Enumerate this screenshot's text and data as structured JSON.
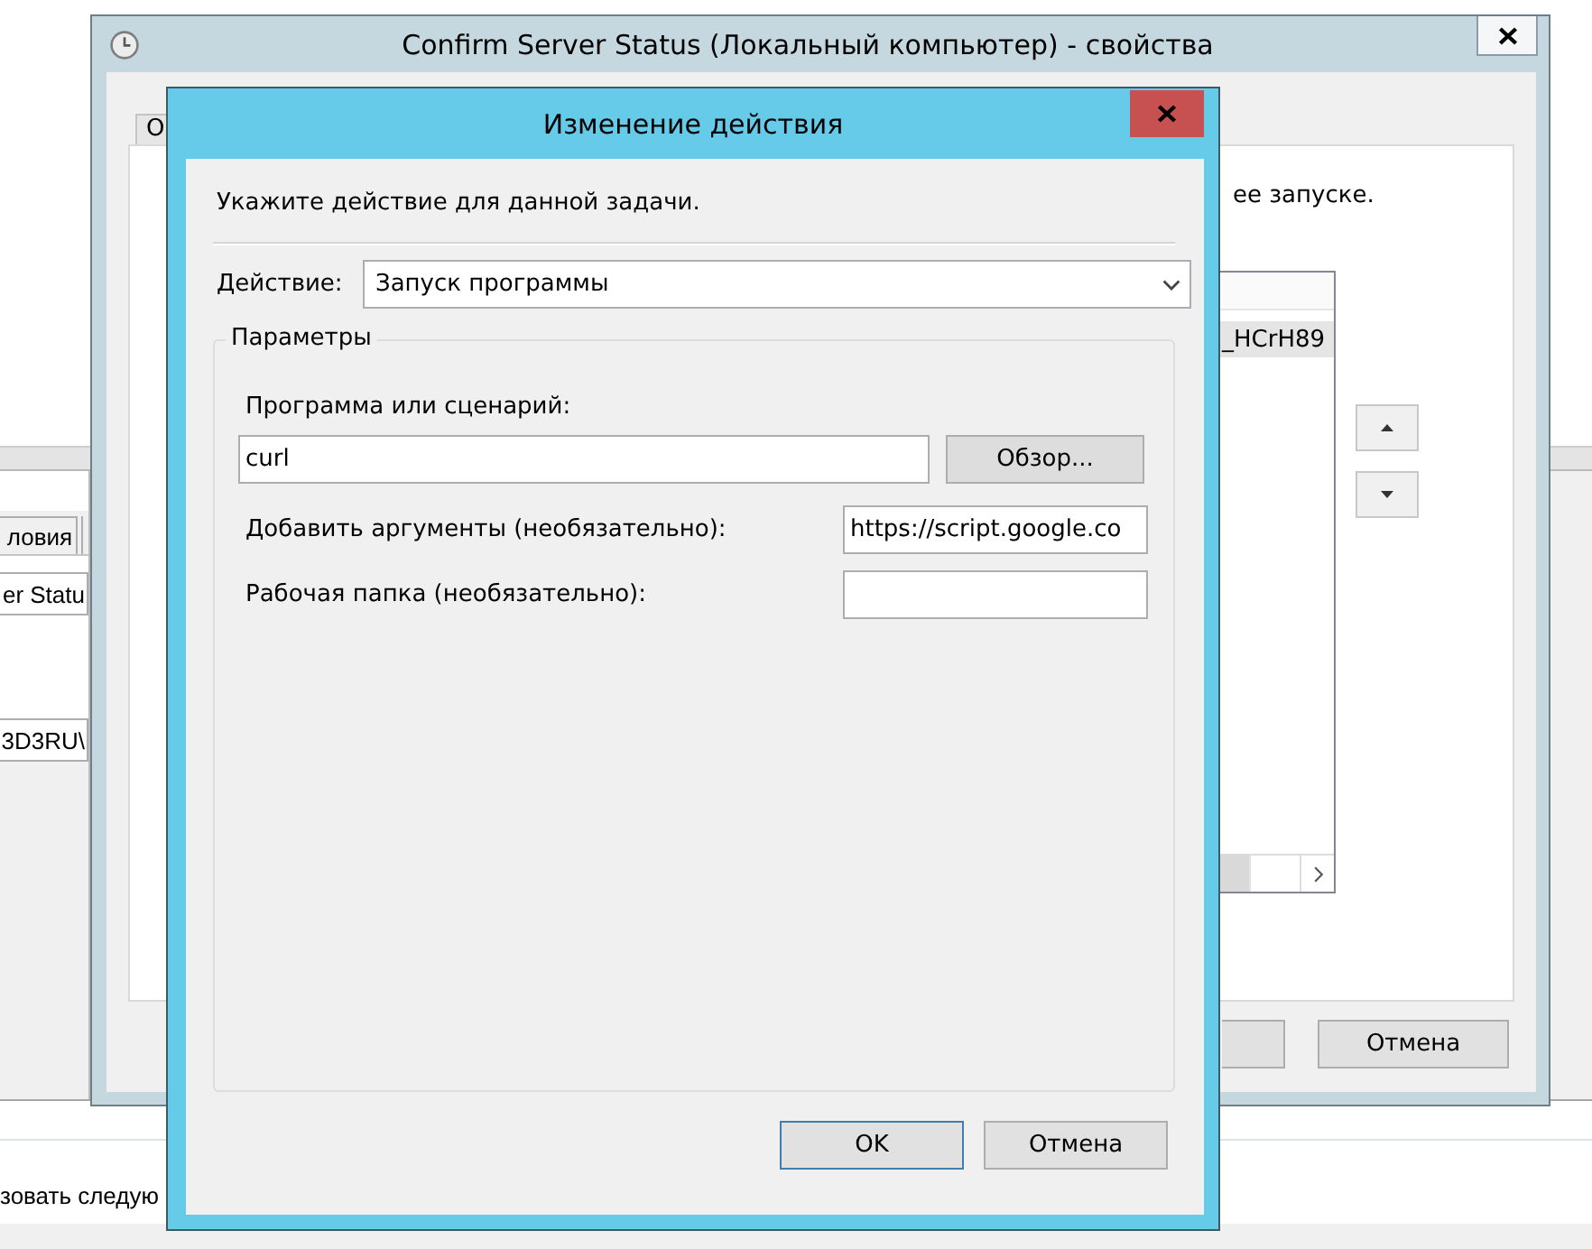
{
  "background_app": {
    "tabs": [
      {
        "label": "ловия",
        "selected": false
      }
    ],
    "fields": [
      {
        "value": "er Statu"
      },
      {
        "value": "3D3RU\\"
      }
    ],
    "footer_text": "зовать следую"
  },
  "properties_window": {
    "title": "Confirm Server Status (Локальный компьютер) - свойства",
    "tabs": [
      {
        "label": "О",
        "selected": false
      }
    ],
    "description": "ее запуске.",
    "actions_list": {
      "rows": [
        {
          "text": "_HCrH89",
          "selected": true
        }
      ]
    },
    "buttons": [
      {
        "label": "Отмена"
      }
    ]
  },
  "action_dialog": {
    "title": "Изменение действия",
    "instruction": "Укажите действие для данной задачи.",
    "action": {
      "label": "Действие:",
      "value": "Запуск программы"
    },
    "parameters": {
      "legend": "Параметры",
      "program": {
        "label": "Программа или сценарий:",
        "value": "curl"
      },
      "browse_button": "Обзор...",
      "arguments": {
        "label": "Добавить аргументы (необязательно):",
        "value": "https://script.google.co"
      },
      "start_in": {
        "label": "Рабочая папка (необязательно):"
      }
    },
    "buttons": [
      {
        "label": "OK",
        "default": true
      },
      {
        "label": "Отмена",
        "default": false
      }
    ]
  }
}
